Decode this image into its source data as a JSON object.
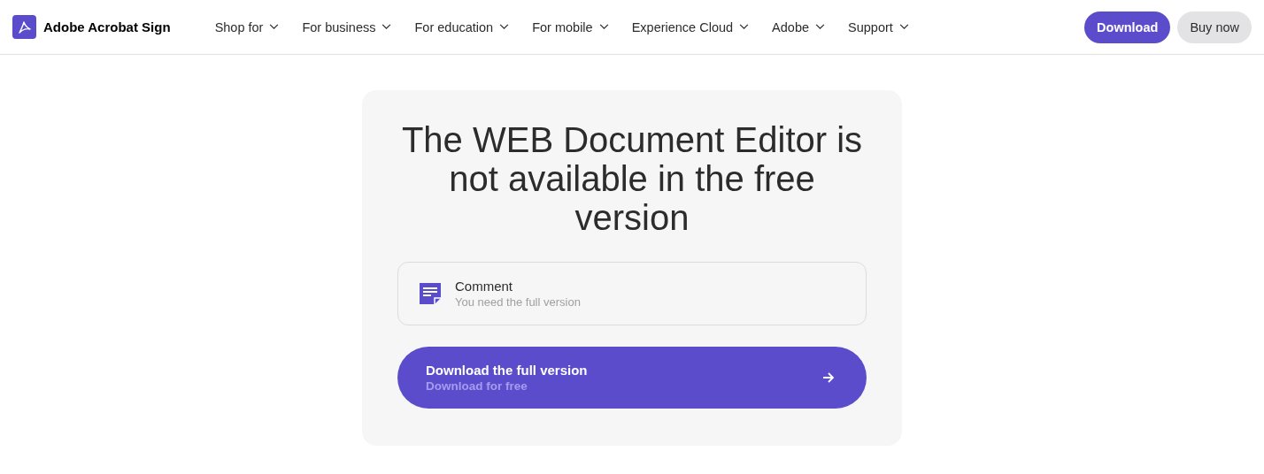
{
  "header": {
    "brand": "Adobe Acrobat Sign",
    "nav": [
      {
        "label": "Shop for"
      },
      {
        "label": "For business"
      },
      {
        "label": "For education"
      },
      {
        "label": "For mobile"
      },
      {
        "label": "Experience Cloud"
      },
      {
        "label": "Adobe"
      },
      {
        "label": "Support"
      }
    ],
    "buttons": [
      {
        "label": "Download",
        "kind": "primary"
      },
      {
        "label": "Buy now",
        "kind": "secondary"
      }
    ]
  },
  "card": {
    "title": "The WEB Document Editor is not available in the free version",
    "feature": {
      "title": "Comment",
      "subtitle": "You need the full version"
    },
    "cta": {
      "label": "Download the full version",
      "sublabel": "Download for free"
    }
  }
}
